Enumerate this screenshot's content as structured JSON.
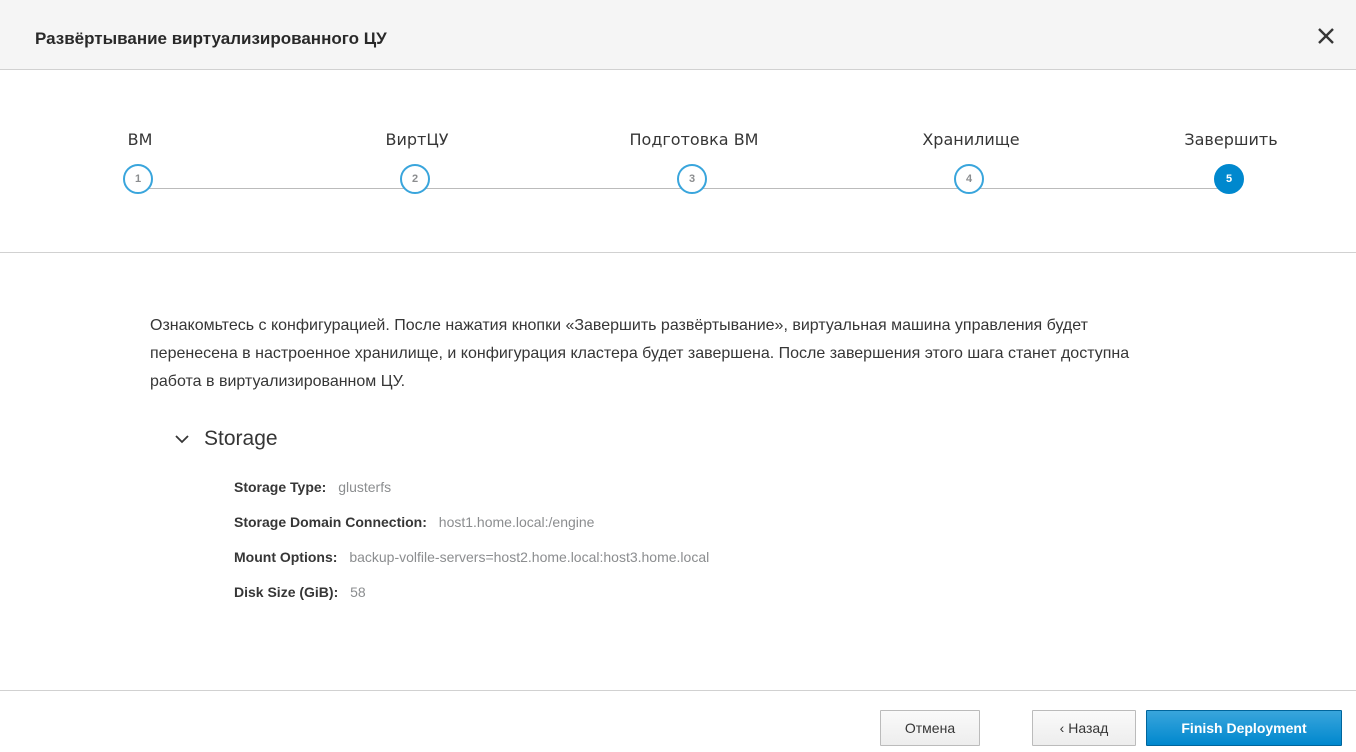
{
  "dialog": {
    "title": "Развёртывание виртуализированного ЦУ"
  },
  "wizard": {
    "steps": [
      {
        "label": "ВМ",
        "number": "1"
      },
      {
        "label": "ВиртЦУ",
        "number": "2"
      },
      {
        "label": "Подготовка ВМ",
        "number": "3"
      },
      {
        "label": "Хранилище",
        "number": "4"
      },
      {
        "label": "Завершить",
        "number": "5"
      }
    ],
    "active_step": 5
  },
  "body": {
    "description": "Ознакомьтесь с конфигурацией. После нажатия кнопки «Завершить развёртывание», виртуальная машина управления будет перенесена в настроенное хранилище, и конфигурация кластера будет завершена. После завершения этого шага станет доступна работа в виртуализированном ЦУ.",
    "section": {
      "title": "Storage",
      "expanded": true,
      "rows": [
        {
          "key": "Storage Type:",
          "value": "glusterfs"
        },
        {
          "key": "Storage Domain Connection:",
          "value": "host1.home.local:/engine"
        },
        {
          "key": "Mount Options:",
          "value": "backup-volfile-servers=host2.home.local:host3.home.local"
        },
        {
          "key": "Disk Size (GiB):",
          "value": "58"
        }
      ]
    }
  },
  "footer": {
    "cancel_label": "Отмена",
    "back_label": "‹ Назад",
    "finish_label": "Finish Deployment"
  },
  "colors": {
    "accent": "#0088ce",
    "step_border": "#39a5dc",
    "header_bg": "#f5f5f5"
  },
  "icons": {
    "close": "close-icon",
    "chevron": "chevron-down-icon"
  }
}
